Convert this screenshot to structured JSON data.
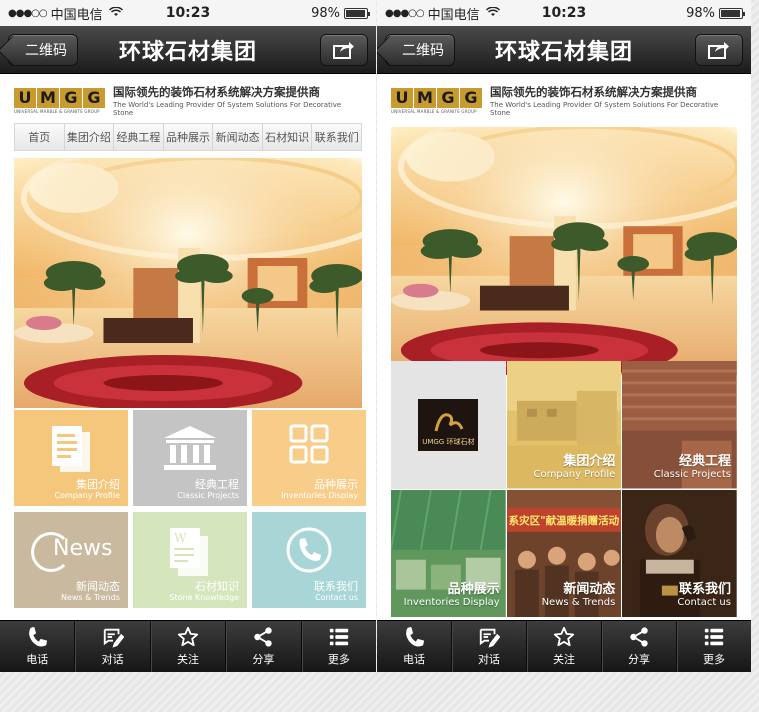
{
  "status": {
    "carrier": "中国电信",
    "time": "10:23",
    "battery": "98%",
    "battery_level": 0.98
  },
  "nav": {
    "back_label": "二维码",
    "title": "环球石材集团"
  },
  "brand": {
    "logo_letters": [
      "U",
      "M",
      "G",
      "G"
    ],
    "logo_sub": "UNIVERSAL MARBLE & GRANITE GROUP",
    "tagline_cn": "国际领先的装饰石材系统解决方案提供商",
    "tagline_en": "The World's Leading Provider Of System Solutions For Decorative Stone"
  },
  "menu": [
    "首页",
    "集团介绍",
    "经典工程",
    "品种展示",
    "新闻动态",
    "石材知识",
    "联系我们"
  ],
  "tiles_a": [
    {
      "cn": "集团介绍",
      "en": "Company Profile",
      "color": "#f4c77c",
      "icon": "document-icon"
    },
    {
      "cn": "经典工程",
      "en": "Classic Projects",
      "color": "#c4c4c4",
      "icon": "building-icon"
    },
    {
      "cn": "品种展示",
      "en": "Inventories Display",
      "color": "#f7cd89",
      "icon": "grid-icon"
    },
    {
      "cn": "新闻动态",
      "en": "News & Trends",
      "color": "#c8b99f",
      "icon": "news-icon",
      "icon_text": "News"
    },
    {
      "cn": "石材知识",
      "en": "Stone Knowledge",
      "color": "#d5e6bc",
      "icon": "book-icon"
    },
    {
      "cn": "联系我们",
      "en": "Contact us",
      "color": "#a8d5d6",
      "icon": "phone-icon"
    }
  ],
  "tiles_b": [
    {
      "cn": "",
      "en": "",
      "type": "logo",
      "logo_text": "UMGG 环球石材"
    },
    {
      "cn": "集团介绍",
      "en": "Company Profile"
    },
    {
      "cn": "经典工程",
      "en": "Classic Projects"
    },
    {
      "cn": "品种展示",
      "en": "Inventories Display"
    },
    {
      "cn": "新闻动态",
      "en": "News & Trends",
      "banner_text": "系灾区\"献温暖捐赠活动"
    },
    {
      "cn": "联系我们",
      "en": "Contact us"
    }
  ],
  "toolbar": [
    {
      "label": "电话",
      "icon": "phone-icon"
    },
    {
      "label": "对话",
      "icon": "chat-edit-icon"
    },
    {
      "label": "关注",
      "icon": "star-icon"
    },
    {
      "label": "分享",
      "icon": "share-icon"
    },
    {
      "label": "更多",
      "icon": "list-icon"
    }
  ]
}
